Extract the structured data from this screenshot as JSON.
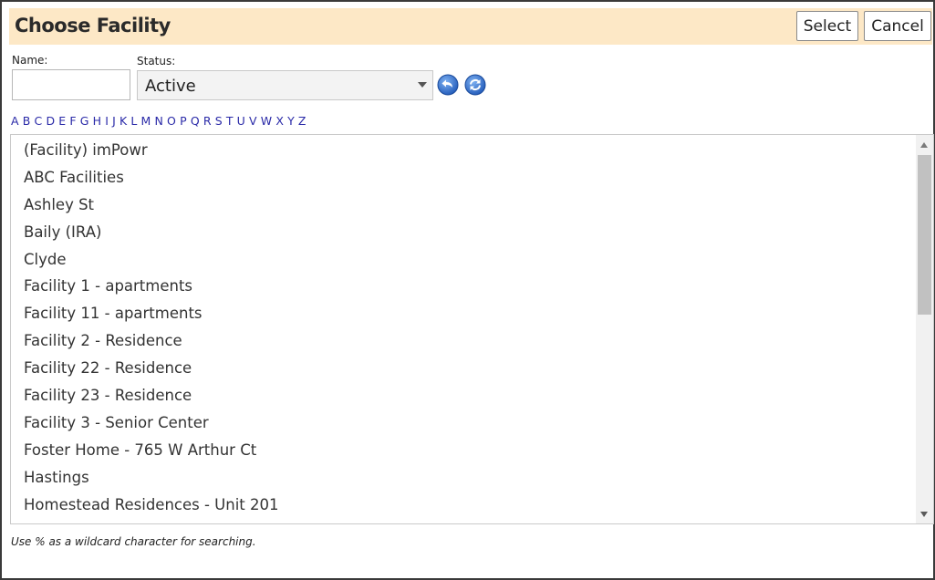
{
  "dialog": {
    "title": "Choose Facility",
    "select_label": "Select",
    "cancel_label": "Cancel"
  },
  "filters": {
    "name_label": "Name:",
    "name_value": "",
    "status_label": "Status:",
    "status_value": "Active"
  },
  "icons": [
    "undo-arrow-icon",
    "refresh-icon"
  ],
  "alphabet": [
    "A",
    "B",
    "C",
    "D",
    "E",
    "F",
    "G",
    "H",
    "I",
    "J",
    "K",
    "L",
    "M",
    "N",
    "O",
    "P",
    "Q",
    "R",
    "S",
    "T",
    "U",
    "V",
    "W",
    "X",
    "Y",
    "Z"
  ],
  "facilities": [
    "(Facility) imPowr",
    "ABC Facilities",
    "Ashley St",
    "Baily (IRA)",
    "Clyde",
    "Facility 1 - apartments",
    "Facility 11 - apartments",
    "Facility 2 - Residence",
    "Facility 22 - Residence",
    "Facility 23 - Residence",
    "Facility 3 - Senior Center",
    "Foster Home - 765 W Arthur Ct",
    "Hastings",
    "Homestead Residences - Unit 201"
  ],
  "footnote": "Use % as a wildcard character for searching.",
  "colors": {
    "header_bg": "#fde8c6",
    "link": "#2a2aa8",
    "icon_blue": "#2f6fd0"
  }
}
